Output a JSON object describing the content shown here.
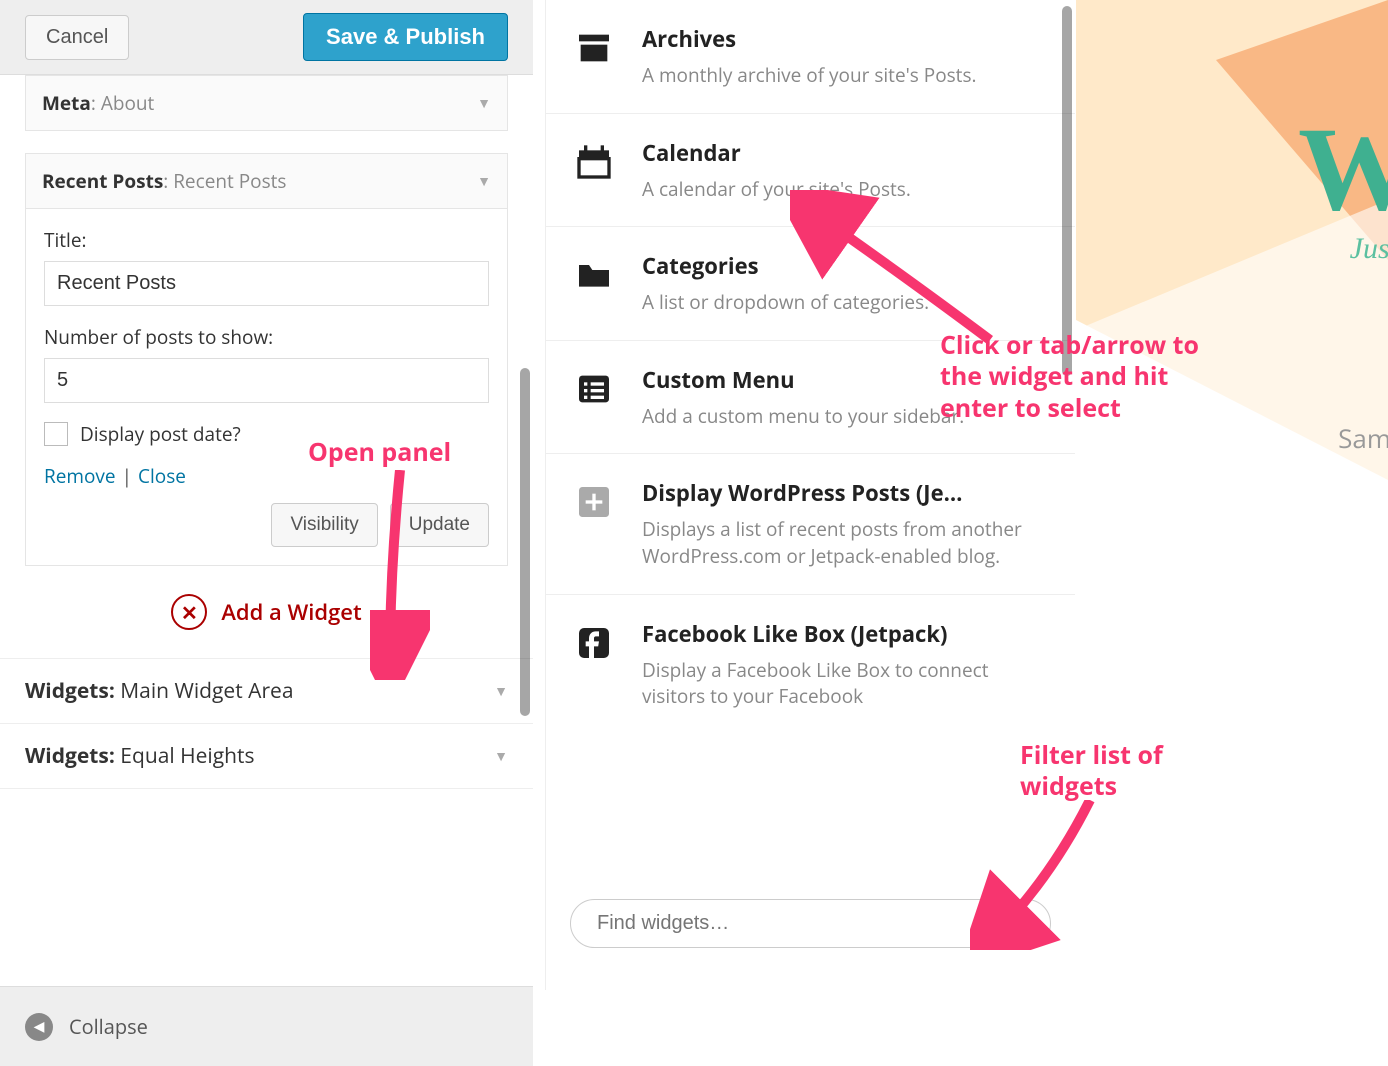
{
  "header": {
    "cancel": "Cancel",
    "save": "Save & Publish"
  },
  "widgets": [
    {
      "name": "Meta",
      "sub": "About"
    },
    {
      "name": "Recent Posts",
      "sub": "Recent Posts"
    }
  ],
  "form": {
    "title_label": "Title:",
    "title_value": "Recent Posts",
    "num_label": "Number of posts to show:",
    "num_value": "5",
    "display_date": "Display post date?",
    "remove": "Remove",
    "close": "Close",
    "visibility": "Visibility",
    "update": "Update"
  },
  "add_widget": "Add a Widget",
  "sections": [
    {
      "prefix": "Widgets:",
      "name": "Main Widget Area"
    },
    {
      "prefix": "Widgets:",
      "name": "Equal Heights"
    }
  ],
  "collapse": "Collapse",
  "chooser": [
    {
      "icon": "archives",
      "title": "Archives",
      "desc": "A monthly archive of your site's Posts."
    },
    {
      "icon": "calendar",
      "title": "Calendar",
      "desc": "A calendar of your site's Posts."
    },
    {
      "icon": "categories",
      "title": "Categories",
      "desc": "A list or dropdown of categories."
    },
    {
      "icon": "menu",
      "title": "Custom Menu",
      "desc": "Add a custom menu to your sidebar."
    },
    {
      "icon": "plus",
      "title": "Display WordPress Posts (Je…",
      "desc": "Displays a list of recent posts from another WordPress.com or Jetpack-enabled blog."
    },
    {
      "icon": "facebook",
      "title": "Facebook Like Box (Jetpack)",
      "desc": "Display a Facebook Like Box to connect visitors to your Facebook"
    }
  ],
  "search_placeholder": "Find widgets…",
  "annotations": {
    "open_panel": "Open panel",
    "click_tab": "Click or tab/arrow to the widget and hit enter to select",
    "filter": "Filter list of widgets"
  },
  "preview": {
    "w": "W",
    "just": "Just",
    "sample": "Sample"
  }
}
